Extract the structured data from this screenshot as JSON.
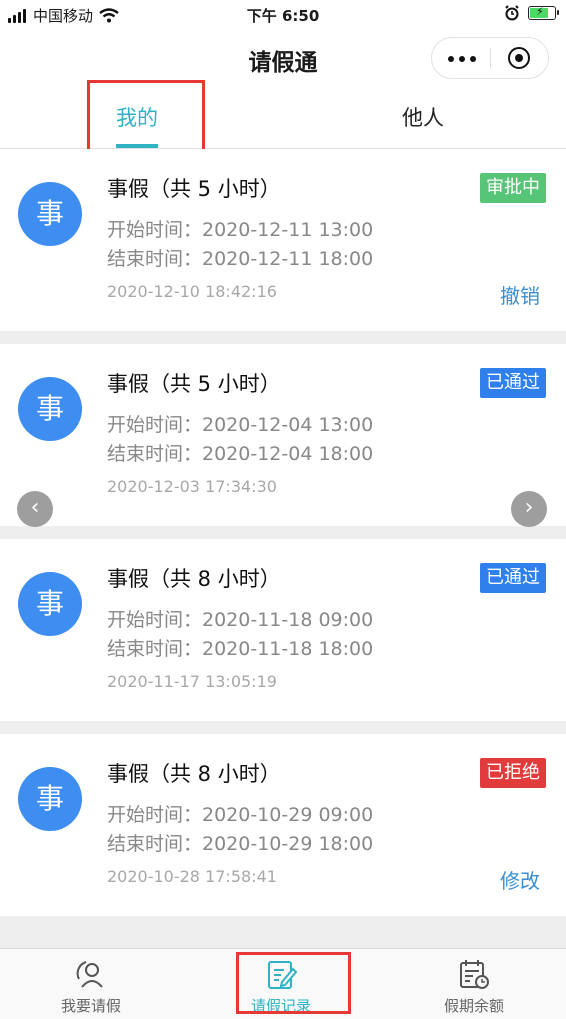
{
  "status_bar": {
    "carrier": "中国移动",
    "time": "下午 6:50"
  },
  "nav": {
    "title": "请假通"
  },
  "tabs": [
    {
      "label": "我的",
      "active": true
    },
    {
      "label": "他人",
      "active": false
    }
  ],
  "records": [
    {
      "avatar": "事",
      "title": "事假（共 5 小时）",
      "status": "审批中",
      "status_color": "#57c577",
      "start": "开始时间：2020-12-11 13:00",
      "end": "结束时间：2020-12-11 18:00",
      "created": "2020-12-10 18:42:16",
      "action": "撤销"
    },
    {
      "avatar": "事",
      "title": "事假（共 5 小时）",
      "status": "已通过",
      "status_color": "#2f80ed",
      "start": "开始时间：2020-12-04 13:00",
      "end": "结束时间：2020-12-04 18:00",
      "created": "2020-12-03 17:34:30",
      "action": ""
    },
    {
      "avatar": "事",
      "title": "事假（共 8 小时）",
      "status": "已通过",
      "status_color": "#2f80ed",
      "start": "开始时间：2020-11-18 09:00",
      "end": "结束时间：2020-11-18 18:00",
      "created": "2020-11-17 13:05:19",
      "action": ""
    },
    {
      "avatar": "事",
      "title": "事假（共 8 小时）",
      "status": "已拒绝",
      "status_color": "#e23b3b",
      "start": "开始时间：2020-10-29 09:00",
      "end": "结束时间：2020-10-29 18:00",
      "created": "2020-10-28 17:58:41",
      "action": "修改"
    }
  ],
  "pager": {
    "prev_icon": "chevron-left-icon",
    "next_icon": "chevron-right-icon"
  },
  "tabbar": [
    {
      "label": "我要请假",
      "icon": "person-icon",
      "active": false
    },
    {
      "label": "请假记录",
      "icon": "edit-record-icon",
      "active": true
    },
    {
      "label": "假期余额",
      "icon": "calendar-clock-icon",
      "active": false
    }
  ],
  "colors": {
    "accent": "#2fb3c4",
    "avatar": "#3d8ef0",
    "link": "#3a8fd3",
    "highlight_box": "#e53935"
  }
}
